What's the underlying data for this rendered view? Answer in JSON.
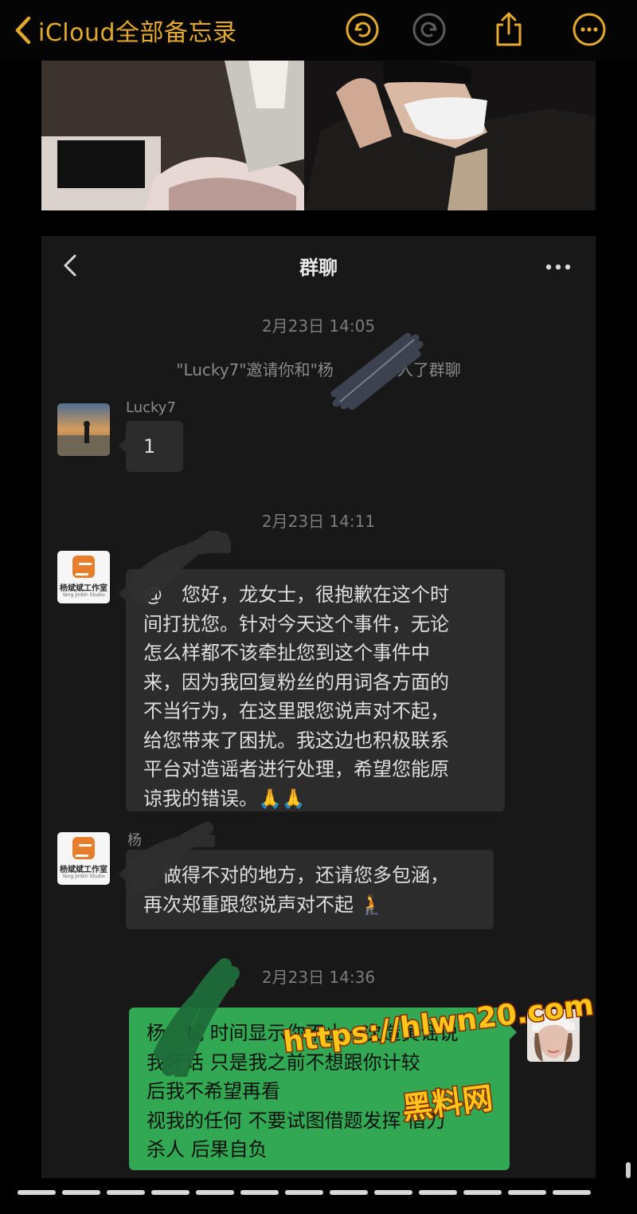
{
  "notes_bar": {
    "back_label": "iCloud全部备忘录",
    "accent_color": "#e3a92e",
    "icons": [
      "chevron-left-icon",
      "undo-icon",
      "redo-icon",
      "share-icon",
      "more-icon"
    ]
  },
  "chat": {
    "title": "群聊",
    "icons": [
      "chevron-left-icon",
      "more-dots-icon"
    ],
    "timestamps": [
      "2月23日 14:05",
      "2月23日 14:11",
      "2月23日 14:36"
    ],
    "system_message": "\"Lucky7\"邀请你和\"杨    入了群聊",
    "messages": [
      {
        "sender": "Lucky7",
        "text": "1"
      },
      {
        "sender": "",
        "text": "@ 您好，龙女士，很抱歉在这个时\n间打扰您。针对今天这个事件，无论\n怎么样都不该牵扯您到这个事件中\n来，因为我回复粉丝的用词各方面的\n不当行为，在这里跟您说声对不起，\n给您带来了困扰。我这边也积极联系\n平台对造谣者进行处理，希望您能原\n谅我的错误。🙏🙏"
      },
      {
        "sender": "杨",
        "text": " 做得不对的地方，还请您多包涵，\n再次郑重跟您说声对不起 🧎"
      },
      {
        "sender": "",
        "text": "杨 斌 时间显示你不止一次造黄谣说\n我坏话 只是我之前不想跟你计较\n后我不希望再看\n视我的任何 不要试图借题发挥 借刀\n杀人 后果自负"
      }
    ],
    "studio_logo": {
      "name": "杨斌斌工作室",
      "sub": "Yang Jinbin Studio"
    }
  },
  "watermark": {
    "url": "https://hlwn20.com",
    "site": "黑料网"
  },
  "colors": {
    "bubble_dark": "#2c2c2c",
    "bubble_green": "#32a852",
    "chat_bg": "#181818"
  }
}
